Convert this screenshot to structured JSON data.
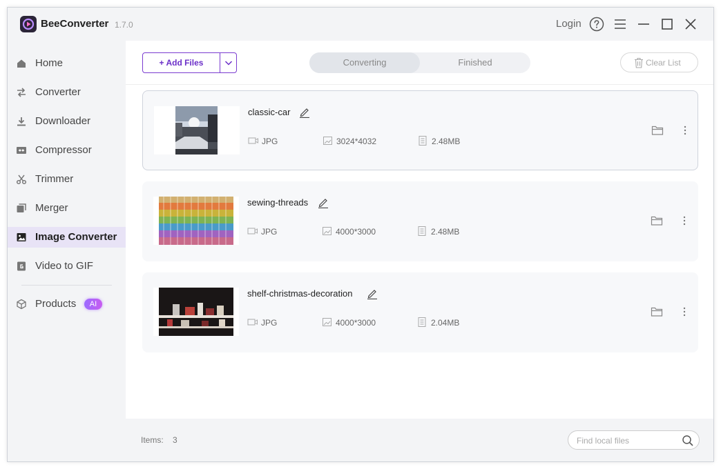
{
  "app": {
    "name": "BeeConverter",
    "version": "1.7.0"
  },
  "titlebar": {
    "login_label": "Login"
  },
  "sidebar": {
    "items": [
      {
        "label": "Home",
        "icon": "home-icon"
      },
      {
        "label": "Converter",
        "icon": "converter-icon"
      },
      {
        "label": "Downloader",
        "icon": "download-icon"
      },
      {
        "label": "Compressor",
        "icon": "compress-icon"
      },
      {
        "label": "Trimmer",
        "icon": "scissors-icon"
      },
      {
        "label": "Merger",
        "icon": "merge-icon"
      },
      {
        "label": "Image Converter",
        "icon": "image-icon",
        "active": true
      },
      {
        "label": "Video to GIF",
        "icon": "gif-icon"
      }
    ],
    "products": {
      "label": "Products",
      "badge": "AI",
      "icon": "cube-icon"
    }
  },
  "toolbar": {
    "add_files_label": "+ Add Files",
    "tabs": [
      {
        "label": "Converting",
        "active": true
      },
      {
        "label": "Finished",
        "active": false
      }
    ],
    "clear_list_label": "Clear List"
  },
  "files": [
    {
      "name": "classic-car",
      "format": "JPG",
      "resolution": "3024*4032",
      "size": "2.48MB"
    },
    {
      "name": "sewing-threads",
      "format": "JPG",
      "resolution": "4000*3000",
      "size": "2.48MB"
    },
    {
      "name": "shelf-christmas-decoration",
      "format": "JPG",
      "resolution": "4000*3000",
      "size": "2.04MB"
    }
  ],
  "footer": {
    "items_label": "Items:",
    "items_count": "3",
    "search_placeholder": "Find local files"
  },
  "colors": {
    "accent": "#6b2fc8",
    "sidebar_bg": "#f3f4f6",
    "active_nav_bg": "#e8e3f6"
  }
}
